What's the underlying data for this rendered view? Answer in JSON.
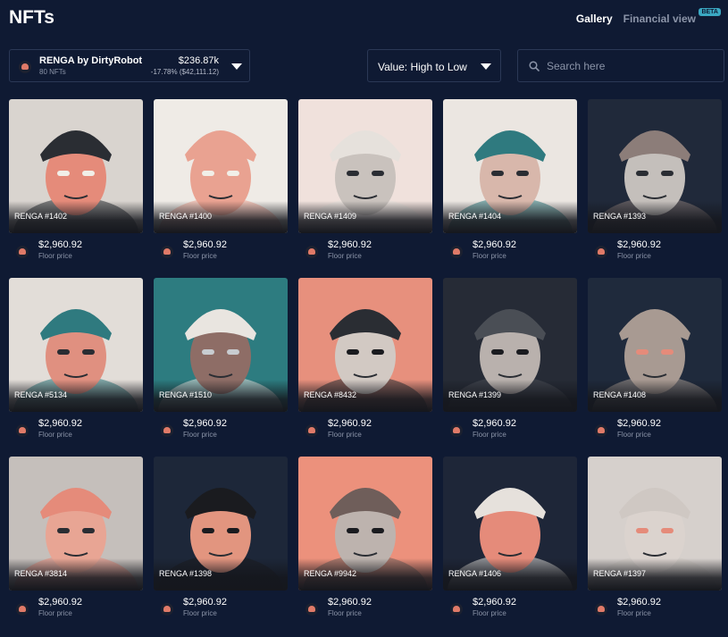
{
  "page": {
    "title": "NFTs"
  },
  "view_tabs": {
    "gallery": "Gallery",
    "financial": "Financial view",
    "beta": "BETA"
  },
  "collection": {
    "name": "RENGA by DirtyRobot",
    "count": "80 NFTs",
    "value": "$236.87k",
    "change": "-17.78% ($42,111.12)"
  },
  "sort": {
    "label": "Value: High to Low"
  },
  "search": {
    "placeholder": "Search here"
  },
  "cards": [
    {
      "name": "RENGA #1402",
      "price": "$2,960.92",
      "floor": "Floor price",
      "bg": "#d9d4cf",
      "skin": "#e58b7a",
      "hat": "#2a2d33",
      "eyes": "#f1efe8"
    },
    {
      "name": "RENGA #1400",
      "price": "$2,960.92",
      "floor": "Floor price",
      "bg": "#efebe6",
      "skin": "#e9a291",
      "hat": "#e9a291",
      "eyes": "#f1efe8"
    },
    {
      "name": "RENGA #1409",
      "price": "$2,960.92",
      "floor": "Floor price",
      "bg": "#f0e1dc",
      "skin": "#c9c2bd",
      "hat": "#e6e1dc",
      "eyes": "#2a2d33"
    },
    {
      "name": "RENGA #1404",
      "price": "$2,960.92",
      "floor": "Floor price",
      "bg": "#ebe6e1",
      "skin": "#d8b7ab",
      "hat": "#2f7a7f",
      "eyes": "#2a2d33"
    },
    {
      "name": "RENGA #1393",
      "price": "$2,960.92",
      "floor": "Floor price",
      "bg": "#20293a",
      "skin": "#c4bfbb",
      "hat": "#8c7d79",
      "eyes": "#2a2d33"
    },
    {
      "name": "RENGA #5134",
      "price": "$2,960.92",
      "floor": "Floor price",
      "bg": "#e2ddd8",
      "skin": "#e09080",
      "hat": "#2f7a7f",
      "eyes": "#2a2d33"
    },
    {
      "name": "RENGA #1510",
      "price": "$2,960.92",
      "floor": "Floor price",
      "bg": "#2d7c80",
      "skin": "#8e6d66",
      "hat": "#e9e5e0",
      "eyes": "#c8ccd0"
    },
    {
      "name": "RENGA #8432",
      "price": "$2,960.92",
      "floor": "Floor price",
      "bg": "#e7907d",
      "skin": "#d2c9c3",
      "hat": "#2a2d33",
      "eyes": "#1a1b1f"
    },
    {
      "name": "RENGA #1399",
      "price": "$2,960.92",
      "floor": "Floor price",
      "bg": "#262b36",
      "skin": "#b9b1ad",
      "hat": "#4a4e55",
      "eyes": "#1a1b1f"
    },
    {
      "name": "RENGA #1408",
      "price": "$2,960.92",
      "floor": "Floor price",
      "bg": "#1f2a3c",
      "skin": "#a89a92",
      "hat": "#a89a92",
      "eyes": "#e58b7a"
    },
    {
      "name": "RENGA #3814",
      "price": "$2,960.92",
      "floor": "Floor price",
      "bg": "#c5bfbb",
      "skin": "#e8a594",
      "hat": "#e58b7a",
      "eyes": "#2a2d33"
    },
    {
      "name": "RENGA #1398",
      "price": "$2,960.92",
      "floor": "Floor price",
      "bg": "#1d2739",
      "skin": "#e2957f",
      "hat": "#1a1b1f",
      "eyes": "#1a1b1f"
    },
    {
      "name": "RENGA #9942",
      "price": "$2,960.92",
      "floor": "Floor price",
      "bg": "#ec917c",
      "skin": "#bdb3ae",
      "hat": "#6f5e5a",
      "eyes": "#1a1b1f"
    },
    {
      "name": "RENGA #1406",
      "price": "$2,960.92",
      "floor": "Floor price",
      "bg": "#1e2638",
      "skin": "#e58b7a",
      "hat": "#e6e1dc",
      "eyes": "#e58b7a"
    },
    {
      "name": "RENGA #1397",
      "price": "$2,960.92",
      "floor": "Floor price",
      "bg": "#d6d0cc",
      "skin": "#dbd3ce",
      "hat": "#cfc8c3",
      "eyes": "#e58b7a"
    }
  ]
}
